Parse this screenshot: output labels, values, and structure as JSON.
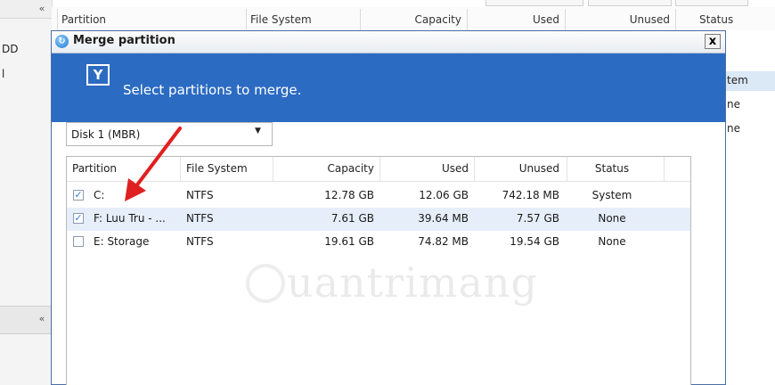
{
  "background_app": {
    "columns": [
      "Partition",
      "File System",
      "Capacity",
      "Used",
      "Unused",
      "Status"
    ],
    "sidebar_text_1": "DD",
    "sidebar_text_2": "l",
    "right_cells": [
      "tem",
      "ne",
      "ne"
    ]
  },
  "dialog": {
    "title": "Merge partition",
    "close_label": "x",
    "banner_text": "Select partitions to merge.",
    "disk_select": {
      "value": "Disk 1 (MBR)"
    },
    "table": {
      "headers": [
        "Partition",
        "File System",
        "Capacity",
        "Used",
        "Unused",
        "Status"
      ],
      "rows": [
        {
          "checked": true,
          "partition": "C:",
          "file_system": "NTFS",
          "capacity": "12.78 GB",
          "used": "12.06 GB",
          "unused": "742.18 MB",
          "status": "System"
        },
        {
          "checked": true,
          "partition": "F: Luu Tru - ...",
          "file_system": "NTFS",
          "capacity": "7.61 GB",
          "used": "39.64 MB",
          "unused": "7.57 GB",
          "status": "None"
        },
        {
          "checked": false,
          "partition": "E: Storage",
          "file_system": "NTFS",
          "capacity": "19.61 GB",
          "used": "74.82 MB",
          "unused": "19.54 GB",
          "status": "None"
        }
      ]
    }
  },
  "watermark": "uantrimang",
  "icons": {
    "app": "merge-dialog-icon",
    "banner": "merge-partition-icon",
    "collapse": "double-chevron-up-icon",
    "arrow": "red-pointer-arrow"
  },
  "colors": {
    "banner": "#2c6bc2",
    "selected_row": "#e6eef9",
    "arrow": "#e02020"
  }
}
